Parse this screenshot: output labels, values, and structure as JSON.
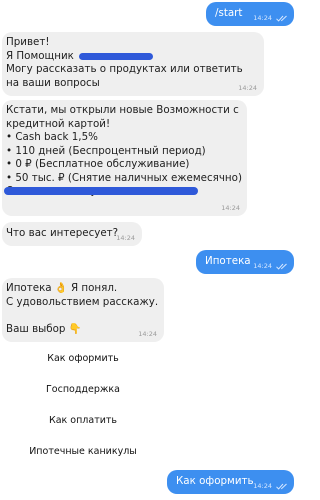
{
  "messages": [
    {
      "dir": "out",
      "text": "/start",
      "time": "14:24"
    },
    {
      "dir": "in",
      "text": "Привет!\nЯ Помощник\nМогу рассказать о продуктах или ответить на ваши вопросы",
      "time": "14:24"
    },
    {
      "dir": "in",
      "text": "Кстати, мы открыли новые Возможности с кредитной картой!\n• Cash back 1,5%\n• 110 дней (Беспроцентный период)\n• 0 ₽ (Бесплатное обслуживание)\n• 50 тыс. ₽ (Снятие наличных ежемесячно)\nОставить заявку:",
      "time": "14:24"
    },
    {
      "dir": "in",
      "text": "Что вас интересует?",
      "time": "14:24"
    },
    {
      "dir": "out",
      "text": "Ипотека",
      "time": "14:24"
    },
    {
      "dir": "in",
      "text": "Ипотека 👌 Я понял.\nС удовольствием расскажу.\n\nВаш выбор 👇",
      "time": "14:24"
    },
    {
      "dir": "out",
      "text": "Как оформить",
      "time": "14:24"
    }
  ],
  "keyboard": {
    "buttons": [
      "Как оформить",
      "Господдержка",
      "Как оплатить",
      "Ипотечные каникулы"
    ]
  },
  "colors": {
    "incoming_bubble": "#efefef",
    "outgoing_bubble": "#3d8ff0",
    "redaction": "#2f59d9"
  },
  "icons": {
    "read_receipt": "double-check-icon"
  }
}
